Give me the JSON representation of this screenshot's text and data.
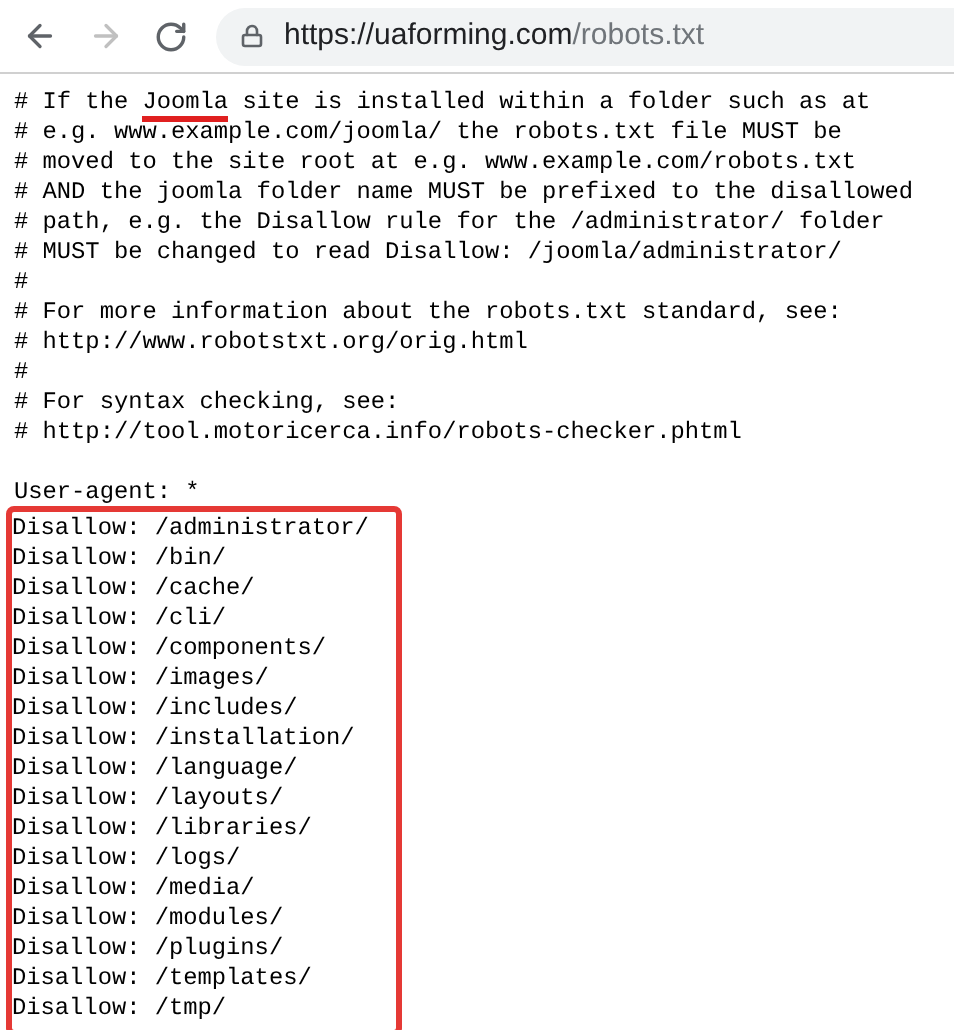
{
  "browser": {
    "back_enabled": true,
    "forward_enabled": false,
    "url_host": "https://uaforming.com",
    "url_path": "/robots.txt"
  },
  "document": {
    "comment_lines": [
      {
        "before": "# If the ",
        "underlined": "Joomla",
        "after": " site is installed within a folder such as at"
      },
      {
        "text": "# e.g. www.example.com/joomla/ the robots.txt file MUST be"
      },
      {
        "text": "# moved to the site root at e.g. www.example.com/robots.txt"
      },
      {
        "text": "# AND the joomla folder name MUST be prefixed to the disallowed"
      },
      {
        "text": "# path, e.g. the Disallow rule for the /administrator/ folder"
      },
      {
        "text": "# MUST be changed to read Disallow: /joomla/administrator/"
      },
      {
        "text": "#"
      },
      {
        "text": "# For more information about the robots.txt standard, see:"
      },
      {
        "text": "# http://www.robotstxt.org/orig.html"
      },
      {
        "text": "#"
      },
      {
        "text": "# For syntax checking, see:"
      },
      {
        "text": "# http://tool.motoricerca.info/robots-checker.phtml"
      }
    ],
    "user_agent": "User-agent: *",
    "disallow_highlighted": true,
    "disallow_lines": [
      "Disallow: /administrator/",
      "Disallow: /bin/",
      "Disallow: /cache/",
      "Disallow: /cli/",
      "Disallow: /components/",
      "Disallow: /images/",
      "Disallow: /includes/",
      "Disallow: /installation/",
      "Disallow: /language/",
      "Disallow: /layouts/",
      "Disallow: /libraries/",
      "Disallow: /logs/",
      "Disallow: /media/",
      "Disallow: /modules/",
      "Disallow: /plugins/",
      "Disallow: /templates/",
      "Disallow: /tmp/"
    ]
  }
}
